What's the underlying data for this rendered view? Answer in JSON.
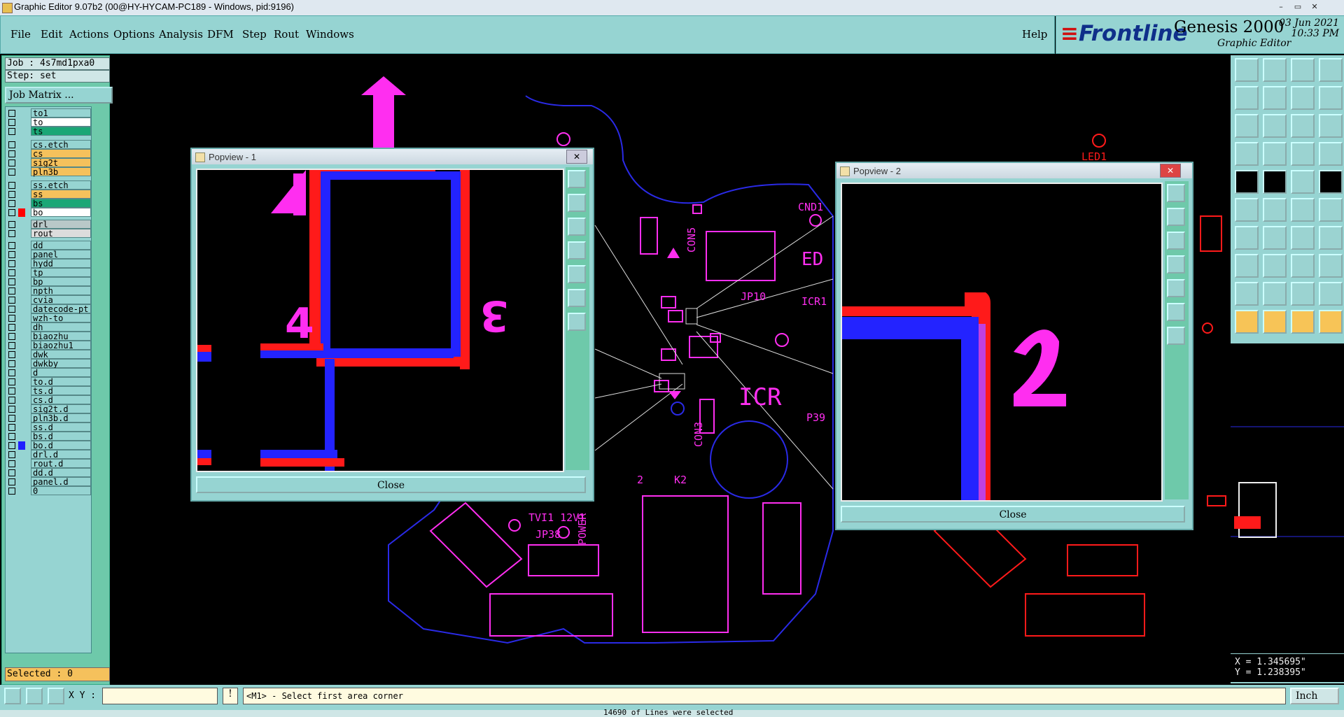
{
  "window": {
    "title": "Graphic Editor 9.07b2 (00@HY-HYCAM-PC189 - Windows, pid:9196)",
    "controls": [
      "–",
      "▭",
      "✕"
    ]
  },
  "menu": {
    "items": [
      "File",
      "Edit",
      "Actions",
      "Options",
      "Analysis",
      "DFM",
      "Step",
      "Rout",
      "Windows"
    ],
    "help": "Help"
  },
  "brand": {
    "logo": "Frontline",
    "product": "Genesis 2000",
    "subtitle": "Graphic Editor",
    "date": "03 Jun 2021",
    "time": "10:33 PM"
  },
  "job": {
    "job_line": "Job : 4s7md1pxa0",
    "step_line": "Step: set",
    "matrix_button": "Job Matrix ..."
  },
  "layers": [
    {
      "name": "to1",
      "color": "#96d4d2",
      "bg": "#96d4d2"
    },
    {
      "name": "to",
      "color": "#96d4d2",
      "bg": "#ffffff"
    },
    {
      "name": "ts",
      "color": "#96d4d2",
      "bg": "#1aa776"
    },
    {
      "name": "cs.etch",
      "color": "#96d4d2",
      "bg": "#96d4d2"
    },
    {
      "name": "cs",
      "color": "#96d4d2",
      "bg": "#f5c15c"
    },
    {
      "name": "sig2t",
      "color": "#96d4d2",
      "bg": "#f5c15c"
    },
    {
      "name": "pln3b",
      "color": "#96d4d2",
      "bg": "#f5c15c"
    },
    {
      "name": "ss.etch",
      "color": "#96d4d2",
      "bg": "#96d4d2"
    },
    {
      "name": "ss",
      "color": "#96d4d2",
      "bg": "#f5c15c"
    },
    {
      "name": "bs",
      "color": "#96d4d2",
      "bg": "#1aa776"
    },
    {
      "name": "bo",
      "color": "#ff0000",
      "bg": "#ffffff"
    },
    {
      "name": "drl",
      "color": "#96d4d2",
      "bg": "#b9c8c8"
    },
    {
      "name": "rout",
      "color": "#96d4d2",
      "bg": "#dcdcdc"
    },
    {
      "name": "dd",
      "color": "#96d4d2",
      "bg": "#96d4d2"
    },
    {
      "name": "panel",
      "color": "#96d4d2",
      "bg": "#96d4d2"
    },
    {
      "name": "hydd",
      "color": "#96d4d2",
      "bg": "#96d4d2"
    },
    {
      "name": "tp",
      "color": "#96d4d2",
      "bg": "#96d4d2"
    },
    {
      "name": "bp",
      "color": "#96d4d2",
      "bg": "#96d4d2"
    },
    {
      "name": "npth",
      "color": "#96d4d2",
      "bg": "#96d4d2"
    },
    {
      "name": "cvia",
      "color": "#96d4d2",
      "bg": "#96d4d2"
    },
    {
      "name": "datecode-pt",
      "color": "#96d4d2",
      "bg": "#96d4d2"
    },
    {
      "name": "wzh-to",
      "color": "#96d4d2",
      "bg": "#96d4d2"
    },
    {
      "name": "dh",
      "color": "#96d4d2",
      "bg": "#96d4d2"
    },
    {
      "name": "biaozhu",
      "color": "#96d4d2",
      "bg": "#96d4d2"
    },
    {
      "name": "biaozhu1",
      "color": "#96d4d2",
      "bg": "#96d4d2"
    },
    {
      "name": "dwk",
      "color": "#96d4d2",
      "bg": "#96d4d2"
    },
    {
      "name": "dwkby",
      "color": "#96d4d2",
      "bg": "#96d4d2"
    },
    {
      "name": "d",
      "color": "#96d4d2",
      "bg": "#96d4d2"
    },
    {
      "name": "to.d",
      "color": "#96d4d2",
      "bg": "#96d4d2"
    },
    {
      "name": "ts.d",
      "color": "#96d4d2",
      "bg": "#96d4d2"
    },
    {
      "name": "cs.d",
      "color": "#96d4d2",
      "bg": "#96d4d2"
    },
    {
      "name": "sig2t.d",
      "color": "#96d4d2",
      "bg": "#96d4d2"
    },
    {
      "name": "pln3b.d",
      "color": "#96d4d2",
      "bg": "#96d4d2"
    },
    {
      "name": "ss.d",
      "color": "#96d4d2",
      "bg": "#96d4d2"
    },
    {
      "name": "bs.d",
      "color": "#96d4d2",
      "bg": "#96d4d2"
    },
    {
      "name": "bo.d",
      "color": "#2020ff",
      "bg": "#96d4d2"
    },
    {
      "name": "drl.d",
      "color": "#96d4d2",
      "bg": "#96d4d2"
    },
    {
      "name": "rout.d",
      "color": "#96d4d2",
      "bg": "#96d4d2"
    },
    {
      "name": "dd.d",
      "color": "#96d4d2",
      "bg": "#96d4d2"
    },
    {
      "name": "panel.d",
      "color": "#96d4d2",
      "bg": "#96d4d2"
    },
    {
      "name": "0",
      "color": "#96d4d2",
      "bg": "#96d4d2"
    }
  ],
  "selected": "Selected : 0",
  "popview1": {
    "title": "Popview - 1",
    "close": "Close"
  },
  "popview2": {
    "title": "Popview - 2",
    "close": "Close"
  },
  "coords": {
    "x": "X = 1.345695\"",
    "y": "Y = 1.238395\""
  },
  "bottom": {
    "xy_label": "X Y :",
    "xy_value": "",
    "prompt": "<M1> - Select first area corner",
    "units": "Inch"
  },
  "status_text": "14690 of Lines were selected",
  "canvas_labels": [
    "CON5",
    "JP10",
    "ICR1",
    "ICR",
    "P39",
    "CON3",
    "K2",
    "2",
    "JP38",
    "TVI1 12V1",
    "POWER",
    "LED1",
    "CND1",
    "ED"
  ],
  "colors": {
    "magenta": "#ff2ef0",
    "red": "#ff1a1a",
    "blue": "#2323ff",
    "outline": "#2a2ae6",
    "panel": "#96d4d2",
    "panel_dark": "#6ec9aa",
    "yellow": "#f5c15c"
  }
}
